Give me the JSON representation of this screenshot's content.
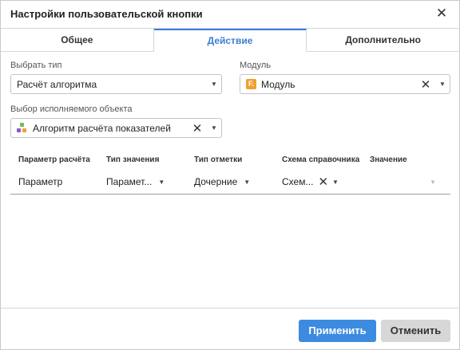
{
  "dialog": {
    "title": "Настройки пользовательской кнопки",
    "close_icon": "close-icon"
  },
  "tabs": [
    {
      "label": "Общее",
      "active": false
    },
    {
      "label": "Действие",
      "active": true
    },
    {
      "label": "Дополнительно",
      "active": false
    }
  ],
  "type_field": {
    "label": "Выбрать тип",
    "value": "Расчёт алгоритма"
  },
  "module_field": {
    "label": "Модуль",
    "value": "Модуль",
    "icon_letter": "F.",
    "icon_color": "#f0a030"
  },
  "object_field": {
    "label": "Выбор исполняемого объекта",
    "value": "Алгоритм расчёта показателей"
  },
  "params_table": {
    "headers": [
      "Параметр расчёта",
      "Тип значения",
      "Тип отметки",
      "Схема справочника",
      "Значение"
    ],
    "rows": [
      {
        "param": "Параметр",
        "value_type": "Парамет...",
        "mark_type": "Дочерние",
        "schema": "Схем...",
        "value": ""
      }
    ]
  },
  "buttons": {
    "apply": "Применить",
    "cancel": "Отменить"
  },
  "colors": {
    "accent": "#3a7fd6",
    "apply_bg": "#3d8be0",
    "cancel_bg": "#d7d7d7"
  }
}
